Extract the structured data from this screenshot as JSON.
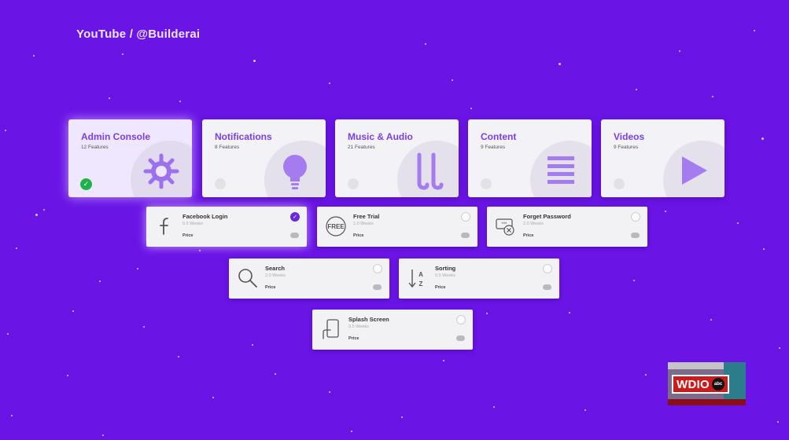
{
  "source_label": "YouTube / @Builderai",
  "colors": {
    "background": "#6a14e6",
    "accent": "#7a3fe6",
    "check_green": "#20b24a",
    "selected_purple": "#6a2ad6"
  },
  "categories": [
    {
      "title": "Admin Console",
      "count": "12 Features",
      "icon": "gear-icon",
      "selected": true
    },
    {
      "title": "Notifications",
      "count": "8 Features",
      "icon": "bulb-icon",
      "selected": false
    },
    {
      "title": "Music & Audio",
      "count": "21 Features",
      "icon": "music-icon",
      "selected": false
    },
    {
      "title": "Content",
      "count": "9 Features",
      "icon": "list-icon",
      "selected": false
    },
    {
      "title": "Videos",
      "count": "9 Features",
      "icon": "play-icon",
      "selected": false
    }
  ],
  "features": [
    {
      "title": "Facebook Login",
      "duration": "0.5 Weeks",
      "price": "Price",
      "icon": "facebook-icon",
      "selected": true
    },
    {
      "title": "Free Trial",
      "duration": "1.0 Weeks",
      "price": "Price",
      "icon": "free-badge-icon",
      "selected": false
    },
    {
      "title": "Forget Password",
      "duration": "2.0 Weeks",
      "price": "Price",
      "icon": "password-reset-icon",
      "selected": false
    },
    {
      "title": "Search",
      "duration": "2.0 Weeks",
      "price": "Price",
      "icon": "search-icon",
      "selected": false
    },
    {
      "title": "Sorting",
      "duration": "0.5 Weeks",
      "price": "Price",
      "icon": "sort-az-icon",
      "selected": false
    },
    {
      "title": "Splash Screen",
      "duration": "0.5 Weeks",
      "price": "Price",
      "icon": "phone-tap-icon",
      "selected": false
    }
  ],
  "badge": {
    "text": "WDIO",
    "network": "abc"
  }
}
